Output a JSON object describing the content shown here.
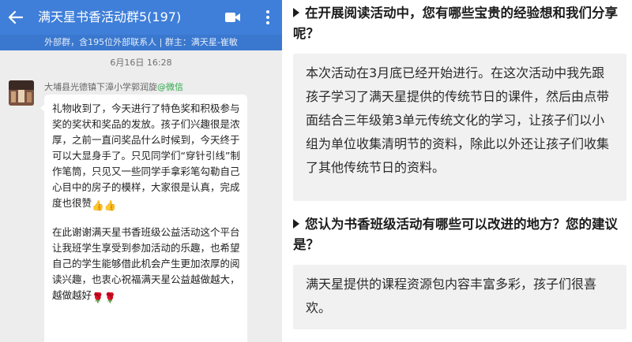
{
  "chat": {
    "title": "满天星书香活动群5(197)",
    "subtitle": "外部群，含195位外部联系人 | 群主：满天星-崔敏",
    "timestamp": "6月16日    16:28",
    "sender": {
      "name": "大埔县光德镇下漳小学郭润旋",
      "source": "@微信"
    },
    "message": {
      "para1": "礼物收到了，今天进行了特色奖和积极参与奖的奖状和奖品的发放。孩子们兴趣很是浓厚，之前一直问奖品什么时候到，今天终于可以大显身手了。只见同学们“穿针引线”制作笔筒，只见又一些同学手拿彩笔勾勒自己心目中的房子的模样，大家很是认真，完成度也很赞",
      "para1_emoji": "👍👍",
      "para2": "在此谢谢满天星书香班级公益活动这个平台让我班学生享受到参加活动的乐趣，也希望自己的学生能够借此机会产生更加浓厚的阅读兴趣，也衷心祝福满天星公益越做越大，越做越好",
      "para2_emoji": "🌹🌹"
    },
    "colors": {
      "titlebar": "#3f7fd9",
      "background": "#ededed"
    },
    "icons": [
      "back-arrow-icon",
      "video-call-icon",
      "more-menu-icon"
    ]
  },
  "qa": [
    {
      "question": "在开展阅读活动中，您有哪些宝贵的经验想和我们分享呢？",
      "answer": "本次活动在3月底已经开始进行。在这次活动中我先跟孩子学习了满天星提供的传统节日的课件，然后由点带面结合三年级第3单元传统文化的学习，让孩子们以小组为单位收集清明节的资料，除此以外还让孩子们收集了其他传统节日的资料。"
    },
    {
      "question": "您认为书香班级活动有哪些可以改进的地方？您的建议是？",
      "answer": "满天星提供的课程资源包内容丰富多彩，孩子们很喜欢。"
    }
  ]
}
